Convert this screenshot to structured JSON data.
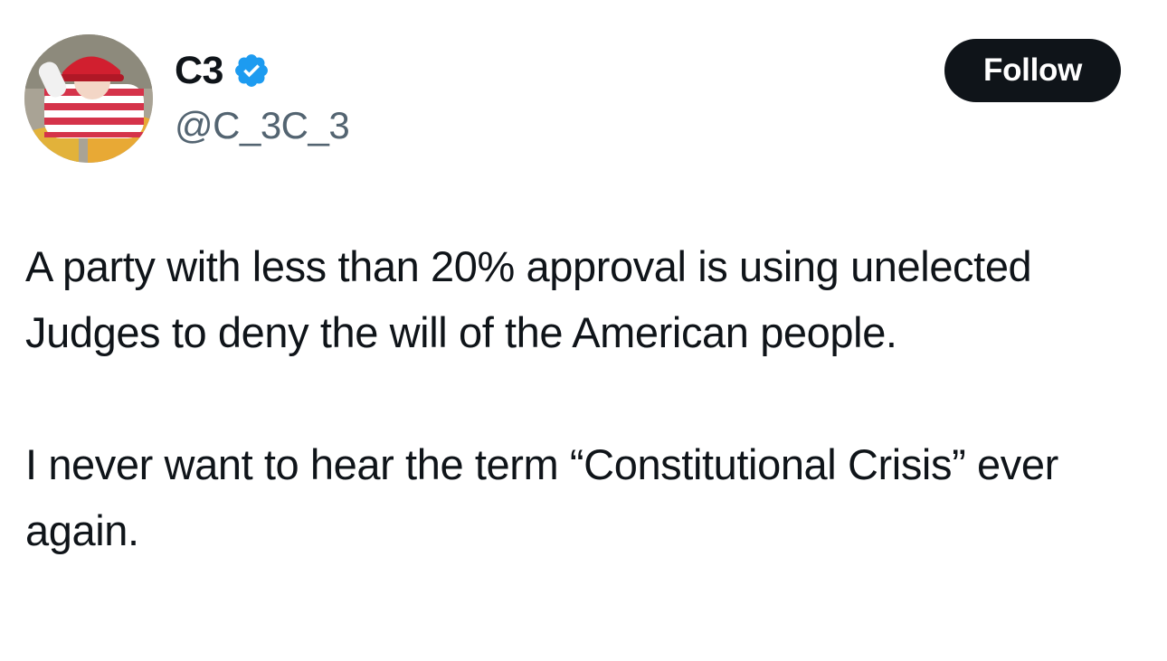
{
  "author": {
    "display_name": "C3",
    "handle": "@C_3C_3",
    "verified": true,
    "avatar_icon": "avatar-photo",
    "verified_icon": "verified-badge-icon"
  },
  "actions": {
    "follow_label": "Follow"
  },
  "tweet": {
    "paragraphs": [
      "A party with less than 20% approval is using unelected Judges to deny the will of the American people.",
      "I never want to hear the term “Constitutional Crisis” ever again."
    ]
  },
  "colors": {
    "text_primary": "#0f1419",
    "text_secondary": "#536471",
    "verified_blue": "#1d9bf0",
    "button_bg": "#0f1419",
    "button_text": "#ffffff"
  }
}
